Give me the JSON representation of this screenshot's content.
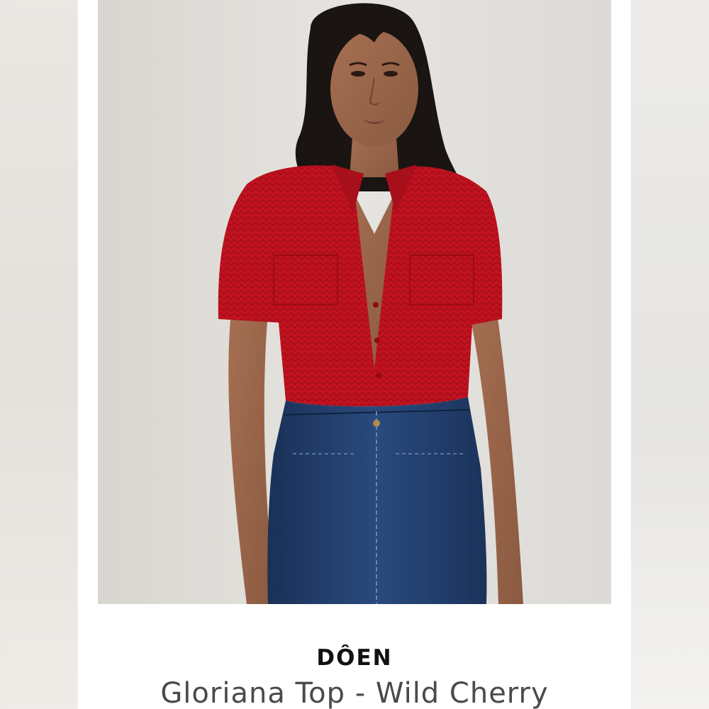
{
  "listing": {
    "image_subject": "model-red-knit-top-blue-jeans",
    "brand": "DÔEN",
    "product_title": "Gloriana Top - Wild Cherry"
  },
  "colors": {
    "top": "#c1121f",
    "denim": "#1f3a66",
    "backdrop": "#e4e1dd",
    "brand_text": "#111111",
    "title_text": "#4a4a4a"
  }
}
